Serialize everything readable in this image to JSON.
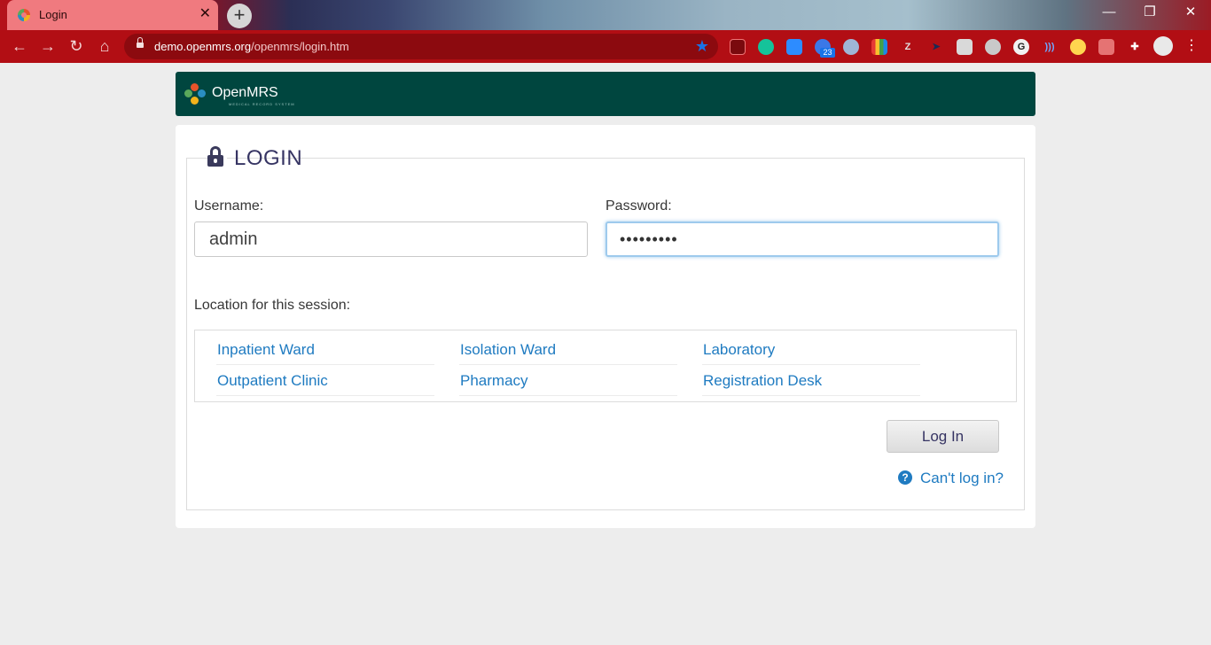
{
  "browser": {
    "tab_title": "Login",
    "tab_close": "✕",
    "new_tab": "+",
    "url_host": "demo.openmrs.org",
    "url_path": "/openmrs/login.htm",
    "badge_count": "23",
    "window_controls": {
      "minimize": "—",
      "restore": "❐",
      "close": "✕"
    },
    "nav": {
      "back": "←",
      "forward": "→",
      "reload": "↻",
      "home": "⌂"
    },
    "bookmark_star": "★",
    "menu": "⋮"
  },
  "brand": {
    "logo_text": "OpenMRS",
    "logo_subtitle": "MEDICAL RECORD SYSTEM"
  },
  "login": {
    "legend": "LOGIN",
    "username_label": "Username:",
    "username_value": "admin",
    "password_label": "Password:",
    "password_value": "•••••••••",
    "location_label": "Location for this session:",
    "locations": [
      "Inpatient Ward",
      "Isolation Ward",
      "Laboratory",
      "Outpatient Clinic",
      "Pharmacy",
      "Registration Desk"
    ],
    "login_button": "Log In",
    "help_icon": "?",
    "cant_login": "Can't log in?"
  },
  "colors": {
    "header_bg": "#00463f",
    "link": "#1f7bc1",
    "legend": "#363463"
  }
}
